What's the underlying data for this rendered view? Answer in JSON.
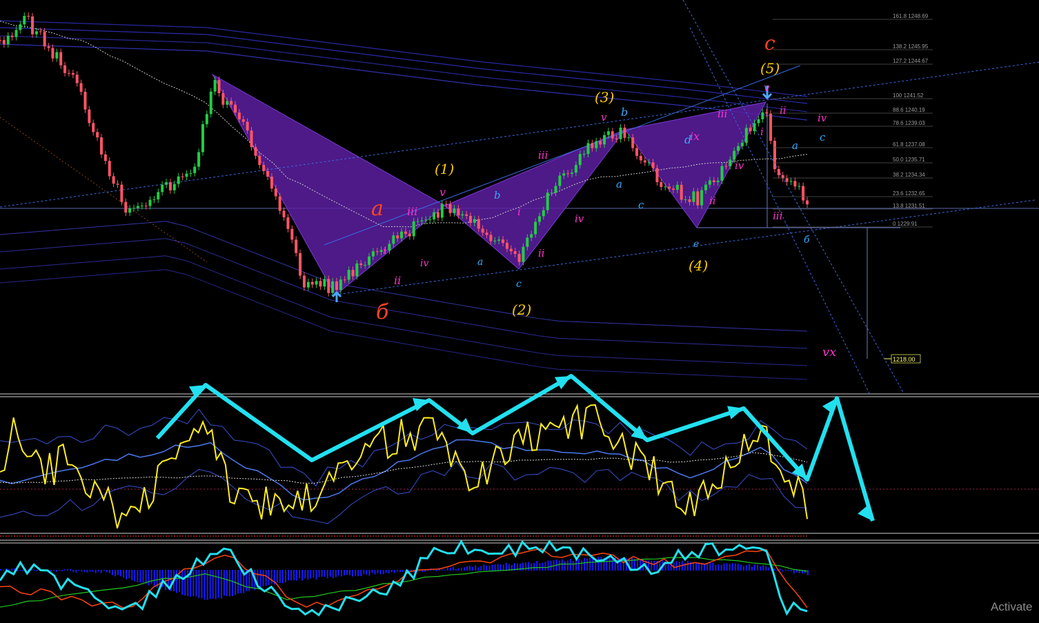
{
  "chart_data": [
    {
      "type": "candlestick",
      "panel": "price",
      "fib_levels": [
        {
          "ratio": "161.8",
          "price": "1248.69"
        },
        {
          "ratio": "138.2",
          "price": "1245.95"
        },
        {
          "ratio": "127.2",
          "price": "1244.67"
        },
        {
          "ratio": "100",
          "price": "1241.52"
        },
        {
          "ratio": "88.6",
          "price": "1240.19"
        },
        {
          "ratio": "78.6",
          "price": "1239.03"
        },
        {
          "ratio": "61.8",
          "price": "1237.08"
        },
        {
          "ratio": "50.0",
          "price": "1235.71"
        },
        {
          "ratio": "38.2",
          "price": "1234.34"
        },
        {
          "ratio": "23.6",
          "price": "1232.65"
        },
        {
          "ratio": "13.8",
          "price": "1231.51"
        },
        {
          "ratio": "0",
          "price": "1229.91"
        }
      ],
      "target_price": "1218.00",
      "wave_labels": [
        {
          "text": "c",
          "color": "#ff4422"
        },
        {
          "text": "(5)",
          "color": "#ffcc00"
        },
        {
          "text": "(3)",
          "color": "#ffcc00"
        },
        {
          "text": "(1)",
          "color": "#ffcc00"
        },
        {
          "text": "(2)",
          "color": "#ffcc00"
        },
        {
          "text": "(4)",
          "color": "#ffcc00"
        },
        {
          "text": "a",
          "color": "#ff4422"
        },
        {
          "text": "б",
          "color": "#ff4422"
        },
        {
          "text": "v",
          "color": "#ff33cc"
        },
        {
          "text": "iii",
          "color": "#ff33cc"
        },
        {
          "text": "i",
          "color": "#ff33cc"
        },
        {
          "text": "ii",
          "color": "#ff33cc"
        },
        {
          "text": "iv",
          "color": "#ff33cc"
        },
        {
          "text": "vx",
          "color": "#ff33cc"
        },
        {
          "text": "ix",
          "color": "#ff33cc"
        },
        {
          "text": "b",
          "color": "#33aaff"
        },
        {
          "text": "a",
          "color": "#33aaff"
        },
        {
          "text": "c",
          "color": "#33aaff"
        },
        {
          "text": "d",
          "color": "#33aaff"
        },
        {
          "text": "e",
          "color": "#33aaff"
        },
        {
          "text": "б",
          "color": "#33aaff"
        }
      ]
    },
    {
      "type": "line",
      "panel": "oscillator",
      "series": []
    },
    {
      "type": "bar",
      "panel": "macd",
      "series": []
    }
  ],
  "watermark": "Activate"
}
